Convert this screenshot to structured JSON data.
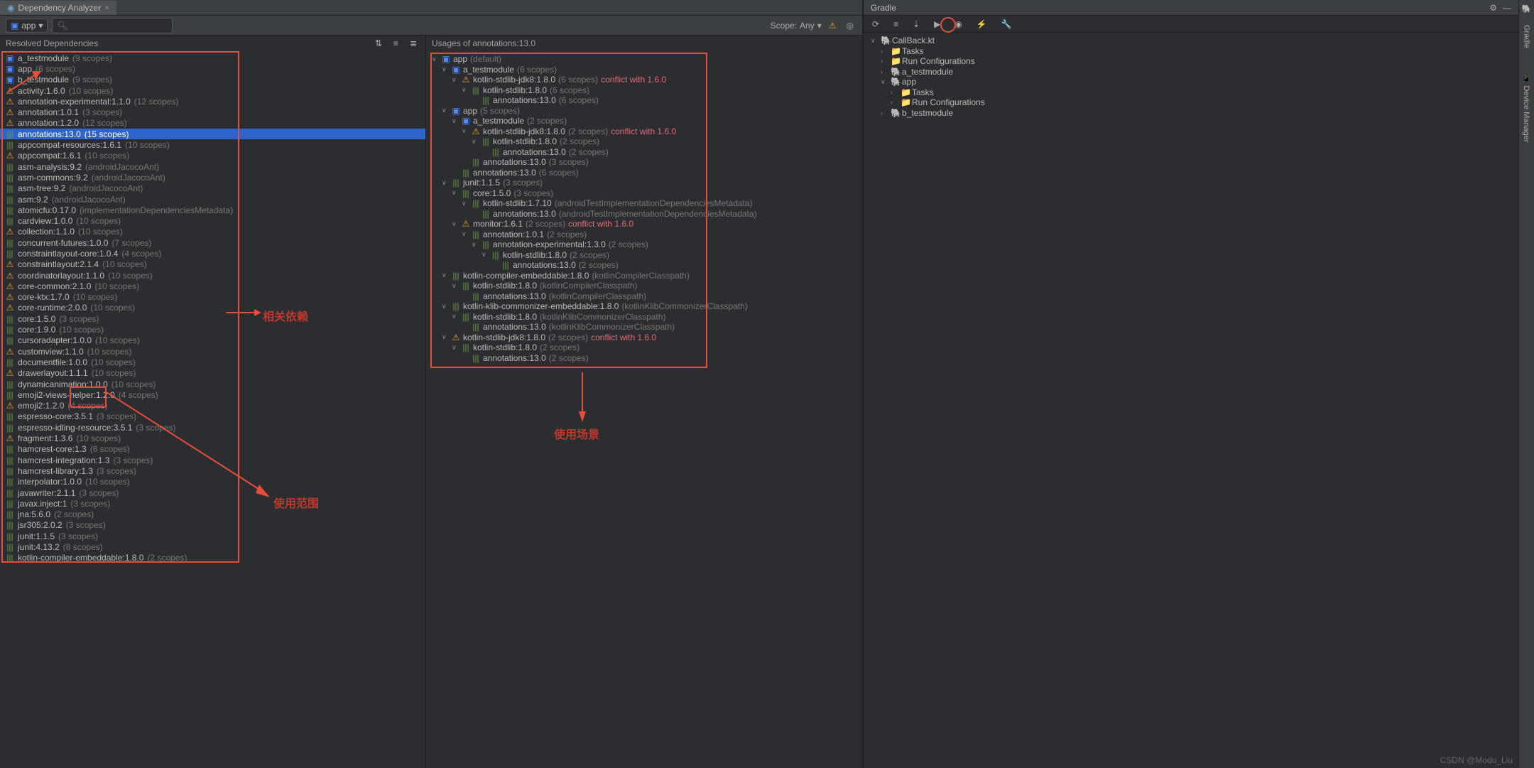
{
  "tab": {
    "title": "Dependency Analyzer"
  },
  "toolbar": {
    "module": "app",
    "search_placeholder": "",
    "scope_label": "Scope:",
    "scope_value": "Any"
  },
  "resolved_header": "Resolved Dependencies",
  "usages_header": "Usages of annotations:13.0",
  "gradle_header": "Gradle",
  "watermark": "CSDN @Modu_Liu",
  "annotations": {
    "related": "相关依赖",
    "scope": "使用范围",
    "usage": "使用场景"
  },
  "deps": [
    {
      "icon": "module",
      "name": "a_testmodule",
      "scopes": "(9 scopes)",
      "warn": false
    },
    {
      "icon": "module",
      "name": "app",
      "scopes": "(6 scopes)",
      "warn": false
    },
    {
      "icon": "module",
      "name": "b_testmodule",
      "scopes": "(9 scopes)",
      "warn": false
    },
    {
      "icon": "lib",
      "name": "activity:1.6.0",
      "scopes": "(10 scopes)",
      "warn": true
    },
    {
      "icon": "lib",
      "name": "annotation-experimental:1.1.0",
      "scopes": "(12 scopes)",
      "warn": true
    },
    {
      "icon": "lib",
      "name": "annotation:1.0.1",
      "scopes": "(3 scopes)",
      "warn": true
    },
    {
      "icon": "lib",
      "name": "annotation:1.2.0",
      "scopes": "(12 scopes)",
      "warn": true
    },
    {
      "icon": "lib",
      "name": "annotations:13.0",
      "scopes": "(15 scopes)",
      "warn": false,
      "selected": true
    },
    {
      "icon": "lib",
      "name": "appcompat-resources:1.6.1",
      "scopes": "(10 scopes)",
      "warn": false
    },
    {
      "icon": "lib",
      "name": "appcompat:1.6.1",
      "scopes": "(10 scopes)",
      "warn": true
    },
    {
      "icon": "lib",
      "name": "asm-analysis:9.2",
      "scopes": "(androidJacocoAnt)",
      "warn": false
    },
    {
      "icon": "lib",
      "name": "asm-commons:9.2",
      "scopes": "(androidJacocoAnt)",
      "warn": false
    },
    {
      "icon": "lib",
      "name": "asm-tree:9.2",
      "scopes": "(androidJacocoAnt)",
      "warn": false
    },
    {
      "icon": "lib",
      "name": "asm:9.2",
      "scopes": "(androidJacocoAnt)",
      "warn": false
    },
    {
      "icon": "lib",
      "name": "atomicfu:0.17.0",
      "scopes": "(implementationDependenciesMetadata)",
      "warn": false
    },
    {
      "icon": "lib",
      "name": "cardview:1.0.0",
      "scopes": "(10 scopes)",
      "warn": false
    },
    {
      "icon": "lib",
      "name": "collection:1.1.0",
      "scopes": "(10 scopes)",
      "warn": true
    },
    {
      "icon": "lib",
      "name": "concurrent-futures:1.0.0",
      "scopes": "(7 scopes)",
      "warn": false
    },
    {
      "icon": "lib",
      "name": "constraintlayout-core:1.0.4",
      "scopes": "(4 scopes)",
      "warn": false
    },
    {
      "icon": "lib",
      "name": "constraintlayout:2.1.4",
      "scopes": "(10 scopes)",
      "warn": true
    },
    {
      "icon": "lib",
      "name": "coordinatorlayout:1.1.0",
      "scopes": "(10 scopes)",
      "warn": true
    },
    {
      "icon": "lib",
      "name": "core-common:2.1.0",
      "scopes": "(10 scopes)",
      "warn": true
    },
    {
      "icon": "lib",
      "name": "core-ktx:1.7.0",
      "scopes": "(10 scopes)",
      "warn": true
    },
    {
      "icon": "lib",
      "name": "core-runtime:2.0.0",
      "scopes": "(10 scopes)",
      "warn": true
    },
    {
      "icon": "lib",
      "name": "core:1.5.0",
      "scopes": "(3 scopes)",
      "warn": false
    },
    {
      "icon": "lib",
      "name": "core:1.9.0",
      "scopes": "(10 scopes)",
      "warn": false
    },
    {
      "icon": "lib",
      "name": "cursoradapter:1.0.0",
      "scopes": "(10 scopes)",
      "warn": false
    },
    {
      "icon": "lib",
      "name": "customview:1.1.0",
      "scopes": "(10 scopes)",
      "warn": true
    },
    {
      "icon": "lib",
      "name": "documentfile:1.0.0",
      "scopes": "(10 scopes)",
      "warn": false
    },
    {
      "icon": "lib",
      "name": "drawerlayout:1.1.1",
      "scopes": "(10 scopes)",
      "warn": true
    },
    {
      "icon": "lib",
      "name": "dynamicanimation:1.0.0",
      "scopes": "(10 scopes)",
      "warn": false
    },
    {
      "icon": "lib",
      "name": "emoji2-views-helper:1.2.0",
      "scopes": "(4 scopes)",
      "warn": false
    },
    {
      "icon": "lib",
      "name": "emoji2:1.2.0",
      "scopes": "(4 scopes)",
      "warn": true
    },
    {
      "icon": "lib",
      "name": "espresso-core:3.5.1",
      "scopes": "(3 scopes)",
      "warn": false
    },
    {
      "icon": "lib",
      "name": "espresso-idling-resource:3.5.1",
      "scopes": "(3 scopes)",
      "warn": false
    },
    {
      "icon": "lib",
      "name": "fragment:1.3.6",
      "scopes": "(10 scopes)",
      "warn": true
    },
    {
      "icon": "lib",
      "name": "hamcrest-core:1.3",
      "scopes": "(8 scopes)",
      "warn": false
    },
    {
      "icon": "lib",
      "name": "hamcrest-integration:1.3",
      "scopes": "(3 scopes)",
      "warn": false
    },
    {
      "icon": "lib",
      "name": "hamcrest-library:1.3",
      "scopes": "(3 scopes)",
      "warn": false
    },
    {
      "icon": "lib",
      "name": "interpolator:1.0.0",
      "scopes": "(10 scopes)",
      "warn": false
    },
    {
      "icon": "lib",
      "name": "javawriter:2.1.1",
      "scopes": "(3 scopes)",
      "warn": false
    },
    {
      "icon": "lib",
      "name": "javax.inject:1",
      "scopes": "(3 scopes)",
      "warn": false
    },
    {
      "icon": "lib",
      "name": "jna:5.6.0",
      "scopes": "(2 scopes)",
      "warn": false
    },
    {
      "icon": "lib",
      "name": "jsr305:2.0.2",
      "scopes": "(3 scopes)",
      "warn": false
    },
    {
      "icon": "lib",
      "name": "junit:1.1.5",
      "scopes": "(3 scopes)",
      "warn": false
    },
    {
      "icon": "lib",
      "name": "junit:4.13.2",
      "scopes": "(8 scopes)",
      "warn": false
    },
    {
      "icon": "lib",
      "name": "kotlin-compiler-embeddable:1.8.0",
      "scopes": "(2 scopes)",
      "warn": false
    }
  ],
  "usages": [
    {
      "ind": 0,
      "chev": "v",
      "icon": "module",
      "name": "app",
      "gray": "(default)"
    },
    {
      "ind": 1,
      "chev": "v",
      "icon": "module",
      "name": "a_testmodule",
      "gray": "(6 scopes)"
    },
    {
      "ind": 2,
      "chev": "v",
      "icon": "lib",
      "warn": true,
      "name": "kotlin-stdlib-jdk8:1.8.0",
      "gray": "(6 scopes)",
      "red": "conflict with 1.6.0"
    },
    {
      "ind": 3,
      "chev": "v",
      "icon": "lib",
      "name": "kotlin-stdlib:1.8.0",
      "gray": "(6 scopes)"
    },
    {
      "ind": 4,
      "chev": "",
      "icon": "lib",
      "name": "annotations:13.0",
      "gray": "(6 scopes)"
    },
    {
      "ind": 1,
      "chev": "v",
      "icon": "module",
      "name": "app",
      "gray": "(5 scopes)"
    },
    {
      "ind": 2,
      "chev": "v",
      "icon": "module",
      "name": "a_testmodule",
      "gray": "(2 scopes)"
    },
    {
      "ind": 3,
      "chev": "v",
      "icon": "lib",
      "warn": true,
      "name": "kotlin-stdlib-jdk8:1.8.0",
      "gray": "(2 scopes)",
      "red": "conflict with 1.6.0"
    },
    {
      "ind": 4,
      "chev": "v",
      "icon": "lib",
      "name": "kotlin-stdlib:1.8.0",
      "gray": "(2 scopes)"
    },
    {
      "ind": 5,
      "chev": "",
      "icon": "lib",
      "name": "annotations:13.0",
      "gray": "(2 scopes)"
    },
    {
      "ind": 3,
      "chev": "",
      "icon": "lib",
      "name": "annotations:13.0",
      "gray": "(3 scopes)"
    },
    {
      "ind": 2,
      "chev": "",
      "icon": "lib",
      "name": "annotations:13.0",
      "gray": "(6 scopes)"
    },
    {
      "ind": 1,
      "chev": "v",
      "icon": "lib",
      "name": "junit:1.1.5",
      "gray": "(3 scopes)"
    },
    {
      "ind": 2,
      "chev": "v",
      "icon": "lib",
      "name": "core:1.5.0",
      "gray": "(3 scopes)"
    },
    {
      "ind": 3,
      "chev": "v",
      "icon": "lib",
      "name": "kotlin-stdlib:1.7.10",
      "gray": "(androidTestImplementationDependenciesMetadata)"
    },
    {
      "ind": 4,
      "chev": "",
      "icon": "lib",
      "name": "annotations:13.0",
      "gray": "(androidTestImplementationDependenciesMetadata)"
    },
    {
      "ind": 2,
      "chev": "v",
      "icon": "lib",
      "warn": true,
      "name": "monitor:1.6.1",
      "gray": "(2 scopes)",
      "red": "conflict with 1.6.0"
    },
    {
      "ind": 3,
      "chev": "v",
      "icon": "lib",
      "name": "annotation:1.0.1",
      "gray": "(2 scopes)"
    },
    {
      "ind": 4,
      "chev": "v",
      "icon": "lib",
      "name": "annotation-experimental:1.3.0",
      "gray": "(2 scopes)"
    },
    {
      "ind": 5,
      "chev": "v",
      "icon": "lib",
      "name": "kotlin-stdlib:1.8.0",
      "gray": "(2 scopes)"
    },
    {
      "ind": 6,
      "chev": "",
      "icon": "lib",
      "name": "annotations:13.0",
      "gray": "(2 scopes)"
    },
    {
      "ind": 1,
      "chev": "v",
      "icon": "lib",
      "name": "kotlin-compiler-embeddable:1.8.0",
      "gray": "(kotlinCompilerClasspath)"
    },
    {
      "ind": 2,
      "chev": "v",
      "icon": "lib",
      "name": "kotlin-stdlib:1.8.0",
      "gray": "(kotlinCompilerClasspath)"
    },
    {
      "ind": 3,
      "chev": "",
      "icon": "lib",
      "name": "annotations:13.0",
      "gray": "(kotlinCompilerClasspath)"
    },
    {
      "ind": 1,
      "chev": "v",
      "icon": "lib",
      "name": "kotlin-klib-commonizer-embeddable:1.8.0",
      "gray": "(kotlinKlibCommonizerClasspath)"
    },
    {
      "ind": 2,
      "chev": "v",
      "icon": "lib",
      "name": "kotlin-stdlib:1.8.0",
      "gray": "(kotlinKlibCommonizerClasspath)"
    },
    {
      "ind": 3,
      "chev": "",
      "icon": "lib",
      "name": "annotations:13.0",
      "gray": "(kotlinKlibCommonizerClasspath)"
    },
    {
      "ind": 1,
      "chev": "v",
      "icon": "lib",
      "warn": true,
      "name": "kotlin-stdlib-jdk8:1.8.0",
      "gray": "(2 scopes)",
      "red": "conflict with 1.6.0"
    },
    {
      "ind": 2,
      "chev": "v",
      "icon": "lib",
      "name": "kotlin-stdlib:1.8.0",
      "gray": "(2 scopes)"
    },
    {
      "ind": 3,
      "chev": "",
      "icon": "lib",
      "name": "annotations:13.0",
      "gray": "(2 scopes)"
    }
  ],
  "gradle_tree": [
    {
      "ind": 0,
      "chev": "v",
      "icon": "gradle",
      "name": "CallBack.kt"
    },
    {
      "ind": 1,
      "chev": ">",
      "icon": "folder",
      "name": "Tasks"
    },
    {
      "ind": 1,
      "chev": ">",
      "icon": "folder",
      "name": "Run Configurations"
    },
    {
      "ind": 1,
      "chev": ">",
      "icon": "gradle",
      "name": "a_testmodule"
    },
    {
      "ind": 1,
      "chev": "v",
      "icon": "gradle",
      "name": "app",
      "selected": true
    },
    {
      "ind": 2,
      "chev": ">",
      "icon": "folder",
      "name": "Tasks"
    },
    {
      "ind": 2,
      "chev": ">",
      "icon": "folder",
      "name": "Run Configurations"
    },
    {
      "ind": 1,
      "chev": ">",
      "icon": "gradle",
      "name": "b_testmodule"
    }
  ]
}
